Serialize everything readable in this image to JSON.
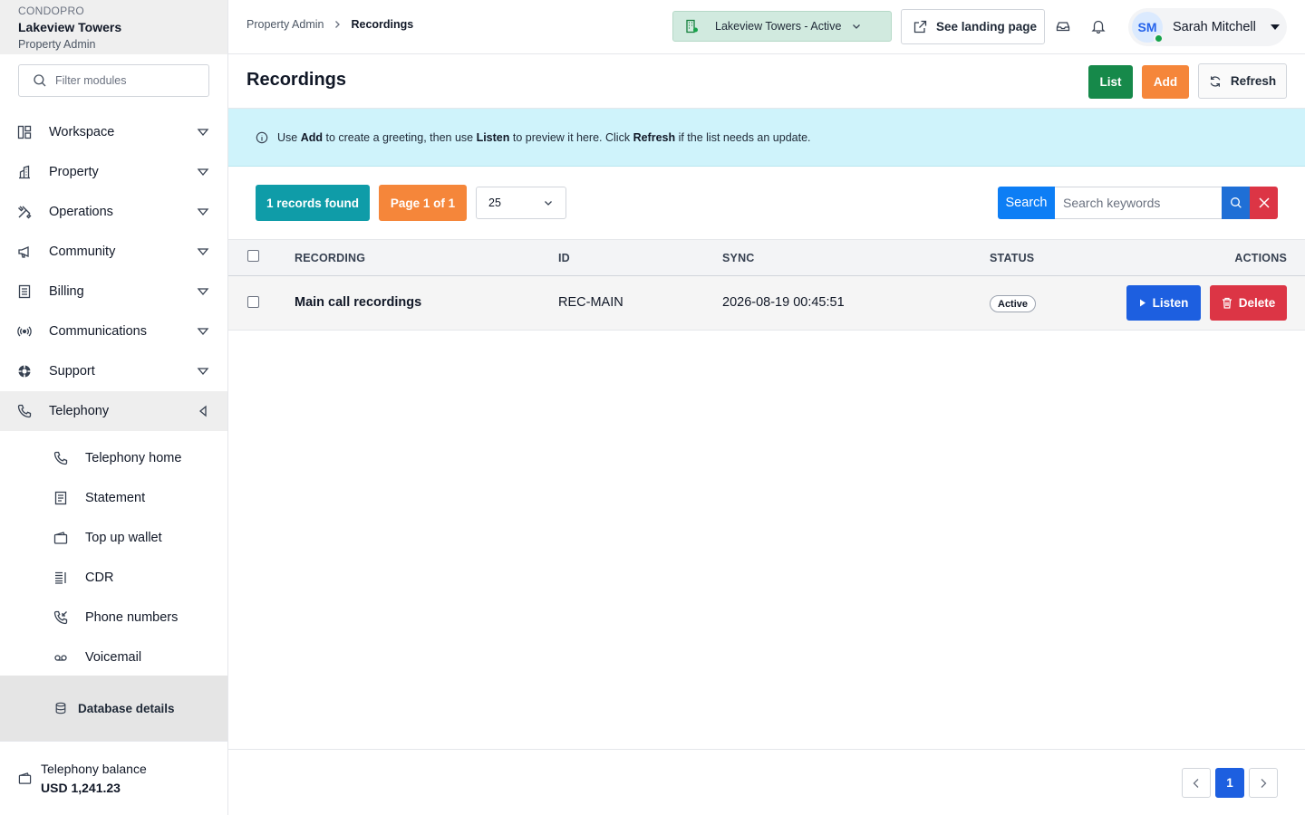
{
  "brand": {
    "app_name": "CONDOPRO",
    "property_name": "Lakeview Towers",
    "role": "Property Admin"
  },
  "sidebar": {
    "filter_placeholder": "Filter modules",
    "items": [
      {
        "label": "Workspace",
        "icon": "layout-icon"
      },
      {
        "label": "Property",
        "icon": "building-icon"
      },
      {
        "label": "Operations",
        "icon": "tools-icon"
      },
      {
        "label": "Community",
        "icon": "megaphone-icon"
      },
      {
        "label": "Billing",
        "icon": "receipt-icon"
      },
      {
        "label": "Communications",
        "icon": "broadcast-icon"
      },
      {
        "label": "Support",
        "icon": "lifebuoy-icon"
      },
      {
        "label": "Telephony",
        "icon": "phone-icon",
        "active": true
      }
    ],
    "telephony_sub": [
      {
        "label": "Telephony home",
        "icon": "phone-icon"
      },
      {
        "label": "Statement",
        "icon": "document-icon"
      },
      {
        "label": "Top up wallet",
        "icon": "wallet-icon"
      },
      {
        "label": "CDR",
        "icon": "list-icon"
      },
      {
        "label": "Phone numbers",
        "icon": "phone-incoming-icon"
      },
      {
        "label": "Voicemail",
        "icon": "voicemail-icon"
      }
    ],
    "database_details": "Database details",
    "balance_label": "Telephony balance",
    "balance_value": "USD 1,241.23"
  },
  "header": {
    "breadcrumb": [
      "Property Admin",
      "Recordings"
    ],
    "property_select": "Lakeview Towers - Active",
    "landing_button": "See landing page",
    "user_initials": "SM",
    "user_name": "Sarah Mitchell"
  },
  "page": {
    "title": "Recordings",
    "list_button": "List",
    "add_button": "Add",
    "refresh_button": "Refresh"
  },
  "banner": {
    "t1": "Use ",
    "b1": "Add",
    "t2": " to create a greeting, then use ",
    "b2": "Listen",
    "t3": " to preview it here. Click ",
    "b3": "Refresh",
    "t4": " if the list needs an update."
  },
  "toolbar": {
    "records_found": "1 records found",
    "page_info": "Page 1 of 1",
    "per_page": "25",
    "search_button": "Search",
    "search_placeholder": "Search keywords"
  },
  "table": {
    "columns": [
      "RECORDING",
      "ID",
      "SYNC",
      "STATUS",
      "ACTIONS"
    ],
    "rows": [
      {
        "recording": "Main call recordings",
        "id": "REC-MAIN",
        "sync": "2026-08-19 00:45:51",
        "status": "Active",
        "listen": "Listen",
        "delete": "Delete"
      }
    ]
  },
  "pagination": {
    "current": "1"
  },
  "colors": {
    "primary": "#1d5fe0",
    "success": "#16894a",
    "warning": "#f5863a",
    "danger": "#dc3545",
    "info": "#0f9ca8",
    "banner_bg": "#cff3fb"
  }
}
